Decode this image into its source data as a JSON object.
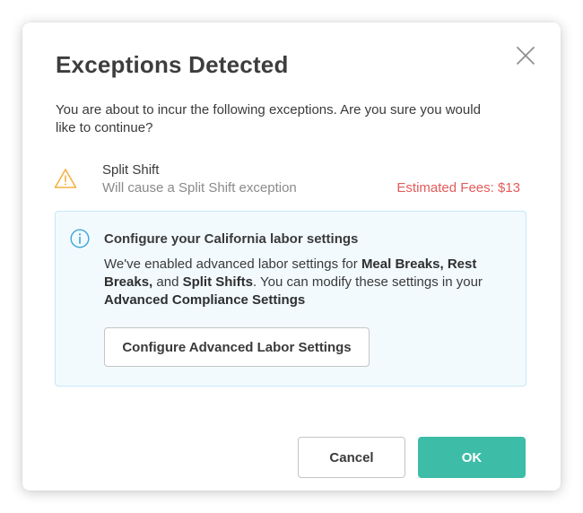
{
  "dialog": {
    "title": "Exceptions Detected",
    "intro": "You are about to incur the following exceptions. Are you sure you would like to continue?",
    "close_icon": "close-icon"
  },
  "exceptions": [
    {
      "icon": "warning-triangle-icon",
      "name": "Split Shift",
      "description": "Will cause a Split Shift exception",
      "fee": "Estimated Fees: $13"
    }
  ],
  "info": {
    "icon": "info-circle-icon",
    "title": "Configure your California labor settings",
    "body": {
      "part1": "We've enabled advanced labor settings for ",
      "bold1": "Meal Breaks, Rest Breaks,",
      "part2": " and ",
      "bold2": "Split Shifts",
      "part3": ". You can modify these settings in your ",
      "bold3": "Advanced Compliance Settings"
    },
    "button_label": "Configure Advanced Labor Settings"
  },
  "footer": {
    "cancel_label": "Cancel",
    "ok_label": "OK"
  },
  "colors": {
    "accent": "#3dbca8",
    "fee_red": "#e35b5b",
    "warning": "#f5b041",
    "info_blue": "#3aa6d8",
    "info_bg": "#f2fafe"
  }
}
